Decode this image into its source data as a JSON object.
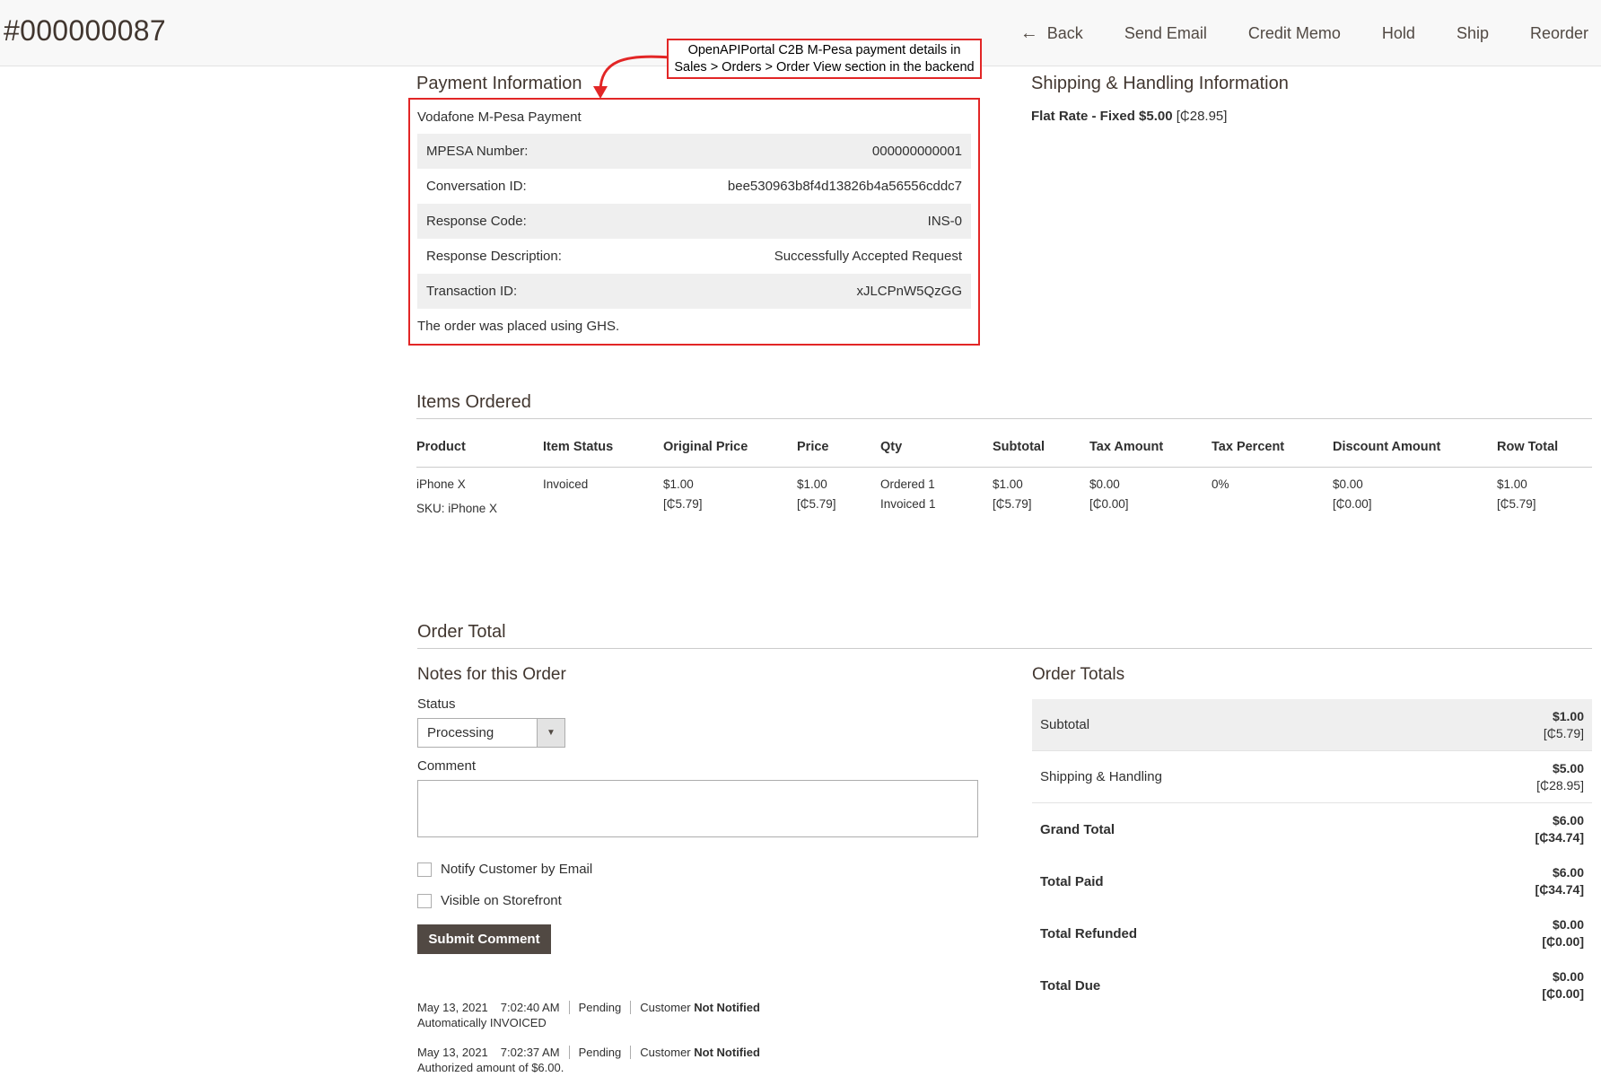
{
  "header": {
    "order_number": "#000000087",
    "actions": [
      "Back",
      "Send Email",
      "Credit Memo",
      "Hold",
      "Ship",
      "Reorder"
    ]
  },
  "callout": {
    "line1": "OpenAPIPortal C2B M-Pesa payment details in",
    "line2": "Sales > Orders > Order View section in the backend",
    "color": "#e22626"
  },
  "payment": {
    "title": "Payment Information",
    "method": "Vodafone M-Pesa Payment",
    "rows": [
      {
        "label": "MPESA Number:",
        "value": "000000000001"
      },
      {
        "label": "Conversation ID:",
        "value": "bee530963b8f4d13826b4a56556cddc7"
      },
      {
        "label": "Response Code:",
        "value": "INS-0"
      },
      {
        "label": "Response Description:",
        "value": "Successfully Accepted Request"
      },
      {
        "label": "Transaction ID:",
        "value": "xJLCPnW5QzGG"
      }
    ],
    "note": "The order was placed using GHS."
  },
  "shipping": {
    "title": "Shipping & Handling Information",
    "method": "Flat Rate - Fixed $5.00",
    "local_price": "[₵28.95]"
  },
  "items": {
    "title": "Items Ordered",
    "columns": [
      "Product",
      "Item Status",
      "Original Price",
      "Price",
      "Qty",
      "Subtotal",
      "Tax Amount",
      "Tax Percent",
      "Discount Amount",
      "Row Total"
    ],
    "rows": [
      {
        "product": "iPhone X",
        "sku": "SKU: iPhone X",
        "status": "Invoiced",
        "original_price": "$1.00",
        "original_price_local": "[₵5.79]",
        "price": "$1.00",
        "price_local": "[₵5.79]",
        "qty_ordered": "Ordered 1",
        "qty_invoiced": "Invoiced 1",
        "subtotal": "$1.00",
        "subtotal_local": "[₵5.79]",
        "tax_amount": "$0.00",
        "tax_amount_local": "[₵0.00]",
        "tax_percent": "0%",
        "discount": "$0.00",
        "discount_local": "[₵0.00]",
        "row_total": "$1.00",
        "row_total_local": "[₵5.79]"
      }
    ]
  },
  "order_total": {
    "title": "Order Total",
    "notes": {
      "title": "Notes for this Order",
      "status_label": "Status",
      "status_value": "Processing",
      "comment_label": "Comment",
      "comment_value": "",
      "notify_label": "Notify Customer by Email",
      "visible_label": "Visible on Storefront",
      "submit_label": "Submit Comment"
    },
    "history": [
      {
        "date": "May 13, 2021",
        "time": "7:02:40 AM",
        "status": "Pending",
        "customer": "Customer",
        "notified": "Not Notified",
        "message": "Automatically INVOICED"
      },
      {
        "date": "May 13, 2021",
        "time": "7:02:37 AM",
        "status": "Pending",
        "customer": "Customer",
        "notified": "Not Notified",
        "message": "Authorized amount of $6.00."
      }
    ],
    "totals_title": "Order Totals",
    "totals": [
      {
        "label": "Subtotal",
        "amount": "$1.00",
        "local": "[₵5.79]"
      },
      {
        "label": "Shipping & Handling",
        "amount": "$5.00",
        "local": "[₵28.95]"
      },
      {
        "label": "Grand Total",
        "amount": "$6.00",
        "local": "[₵34.74]"
      },
      {
        "label": "Total Paid",
        "amount": "$6.00",
        "local": "[₵34.74]"
      },
      {
        "label": "Total Refunded",
        "amount": "$0.00",
        "local": "[₵0.00]"
      },
      {
        "label": "Total Due",
        "amount": "$0.00",
        "local": "[₵0.00]"
      }
    ]
  }
}
